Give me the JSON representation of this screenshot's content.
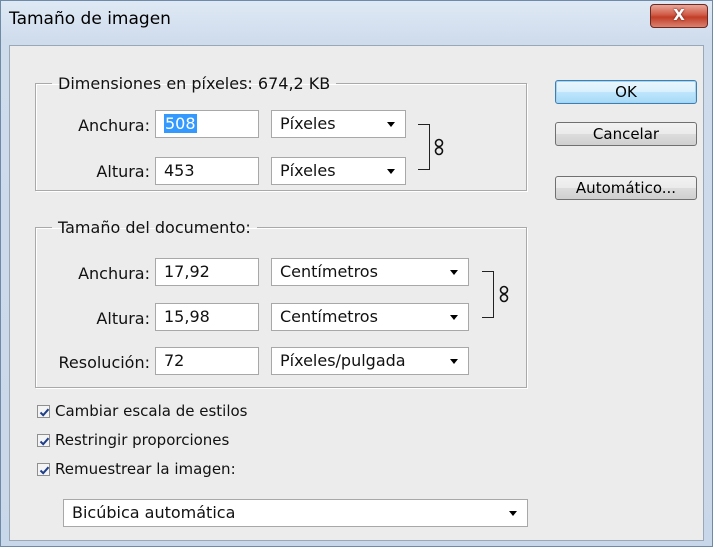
{
  "window": {
    "title": "Tamaño de imagen",
    "close_glyph": "X"
  },
  "pixel_dimensions": {
    "legend": "Dimensiones en píxeles: 674,2 KB",
    "width_label": "Anchura:",
    "width_value": "508",
    "width_unit": "Píxeles",
    "height_label": "Altura:",
    "height_value": "453",
    "height_unit": "Píxeles"
  },
  "document_size": {
    "legend": "Tamaño del documento:",
    "width_label": "Anchura:",
    "width_value": "17,92",
    "width_unit": "Centímetros",
    "height_label": "Altura:",
    "height_value": "15,98",
    "height_unit": "Centímetros",
    "resolution_label": "Resolución:",
    "resolution_value": "72",
    "resolution_unit": "Píxeles/pulgada"
  },
  "buttons": {
    "ok": "OK",
    "cancel": "Cancelar",
    "auto": "Automático..."
  },
  "options": {
    "scale_styles": {
      "label": "Cambiar escala de estilos",
      "checked": true
    },
    "constrain": {
      "label": "Restringir proporciones",
      "checked": true
    },
    "resample": {
      "label": "Remuestrear la imagen:",
      "checked": true
    },
    "resample_method": "Bicúbica automática"
  },
  "icons": {
    "link": "chain-link-icon",
    "dropdown": "chevron-down-icon",
    "check": "checkmark-icon"
  }
}
